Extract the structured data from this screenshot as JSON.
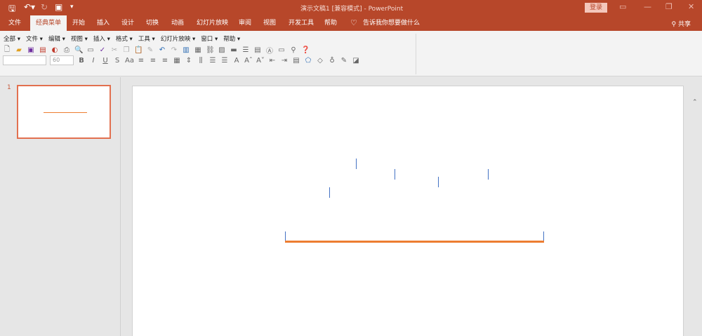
{
  "titlebar": {
    "title": "演示文稿1 [兼容模式] - PowerPoint",
    "login": "登录",
    "qat_icons": [
      "save-icon",
      "undo-icon",
      "redo-icon",
      "presentation-icon",
      "customize-icon"
    ]
  },
  "tabs": [
    "文件",
    "经典菜单",
    "开始",
    "插入",
    "设计",
    "切换",
    "动画",
    "幻灯片放映",
    "审阅",
    "视图",
    "开发工具",
    "帮助"
  ],
  "active_tab": "经典菜单",
  "tell_me": "告诉我你想要做什么",
  "share": "共享",
  "menu": [
    "全部 ▾",
    "文件 ▾",
    "编辑 ▾",
    "视图 ▾",
    "插入 ▾",
    "格式 ▾",
    "工具 ▾",
    "幻灯片放映 ▾",
    "窗口 ▾",
    "帮助 ▾"
  ],
  "font_size": "60",
  "slide_number": "1",
  "colors": {
    "accent": "#b7472a",
    "orange": "#ed7d31",
    "blue": "#4472c4"
  }
}
